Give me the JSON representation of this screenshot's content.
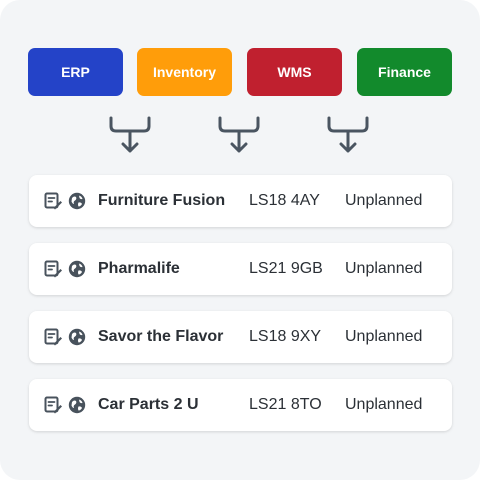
{
  "sources": [
    {
      "label": "ERP",
      "color": "#2443c8"
    },
    {
      "label": "Inventory",
      "color": "#ff9d0a"
    },
    {
      "label": "WMS",
      "color": "#c0202f"
    },
    {
      "label": "Finance",
      "color": "#128a2c"
    }
  ],
  "connector_icon": "merge-arrow-down-icon",
  "row_icons": [
    "document-edit-icon",
    "globe-icon"
  ],
  "records": [
    {
      "name": "Furniture Fusion",
      "postcode": "LS18 4AY",
      "status": "Unplanned"
    },
    {
      "name": "Pharmalife",
      "postcode": "LS21 9GB",
      "status": "Unplanned"
    },
    {
      "name": "Savor the Flavor",
      "postcode": "LS18 9XY",
      "status": "Unplanned"
    },
    {
      "name": "Car Parts 2 U",
      "postcode": "LS21 8TO",
      "status": "Unplanned"
    }
  ]
}
